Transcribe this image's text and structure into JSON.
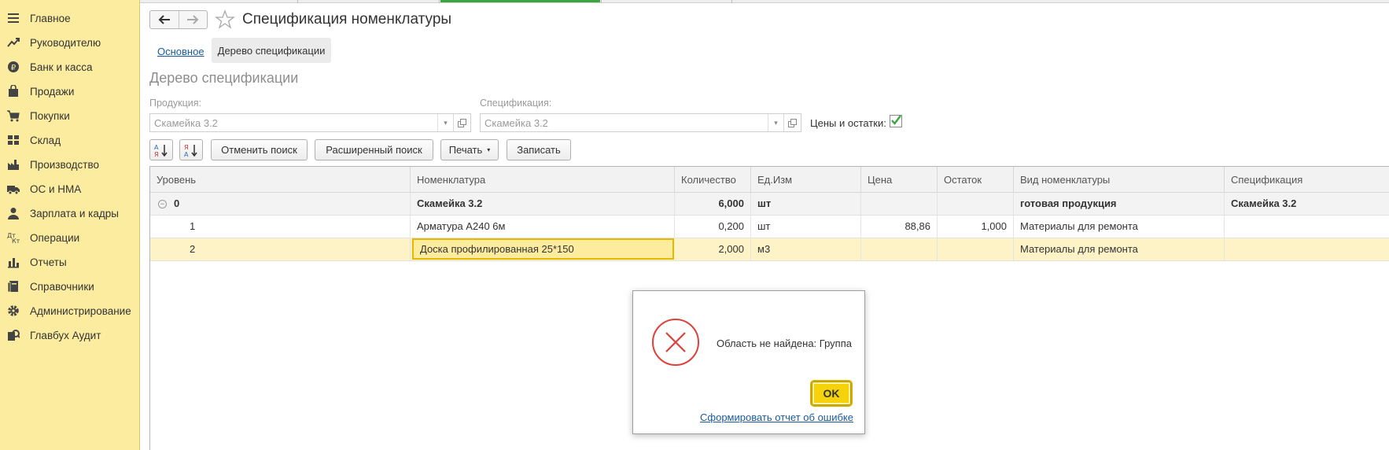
{
  "sidebar": {
    "items": [
      {
        "label": "Главное",
        "icon": "menu-icon"
      },
      {
        "label": "Руководителю",
        "icon": "trend-icon"
      },
      {
        "label": "Банк и касса",
        "icon": "coin-icon"
      },
      {
        "label": "Продажи",
        "icon": "bag-icon"
      },
      {
        "label": "Покупки",
        "icon": "cart-icon"
      },
      {
        "label": "Склад",
        "icon": "warehouse-icon"
      },
      {
        "label": "Производство",
        "icon": "factory-icon"
      },
      {
        "label": "ОС и НМА",
        "icon": "truck-icon"
      },
      {
        "label": "Зарплата и кадры",
        "icon": "person-icon"
      },
      {
        "label": "Операции",
        "icon": "operations-icon"
      },
      {
        "label": "Отчеты",
        "icon": "chart-icon"
      },
      {
        "label": "Справочники",
        "icon": "book-icon"
      },
      {
        "label": "Администрирование",
        "icon": "gear-icon"
      },
      {
        "label": "Главбух Аудит",
        "icon": "audit-icon"
      }
    ]
  },
  "window": {
    "title": "Спецификация номенклатуры"
  },
  "tabs": {
    "basic": "Основное",
    "tree": "Дерево спецификации"
  },
  "section_title": "Дерево спецификации",
  "form": {
    "product_label": "Продукция:",
    "product_value": "Скамейка 3.2",
    "spec_label": "Спецификация:",
    "spec_value": "Скамейка 3.2",
    "prices_label": "Цены и остатки:",
    "prices_checked": true
  },
  "toolbar": {
    "cancel_search": "Отменить поиск",
    "advanced_search": "Расширенный поиск",
    "print": "Печать",
    "save": "Записать"
  },
  "table": {
    "columns": [
      "Уровень",
      "Номенклатура",
      "Количество",
      "Ед.Изм",
      "Цена",
      "Остаток",
      "Вид номенклатуры",
      "Спецификация"
    ],
    "rows": [
      {
        "level": "0",
        "item": "Скамейка 3.2",
        "qty": "6,000",
        "unit": "шт",
        "price": "",
        "stock": "",
        "kind": "готовая продукция",
        "spec": "Скамейка 3.2"
      },
      {
        "level": "1",
        "item": "Арматура А240 6м",
        "qty": "0,200",
        "unit": "шт",
        "price": "88,86",
        "stock": "1,000",
        "kind": "Материалы для ремонта",
        "spec": ""
      },
      {
        "level": "2",
        "item": "Доска профилированная 25*150",
        "qty": "2,000",
        "unit": "м3",
        "price": "",
        "stock": "",
        "kind": "Материалы для ремонта",
        "spec": ""
      }
    ]
  },
  "dialog": {
    "message": "Область не найдена: Группа",
    "ok": "OK",
    "report_link": "Сформировать отчет об ошибке"
  },
  "colors": {
    "sidebar_bg": "#fbec9f",
    "accent_yellow": "#f5d20a",
    "error_red": "#e0403a",
    "link_blue": "#1a5a9c",
    "check_green": "#3aa640"
  }
}
